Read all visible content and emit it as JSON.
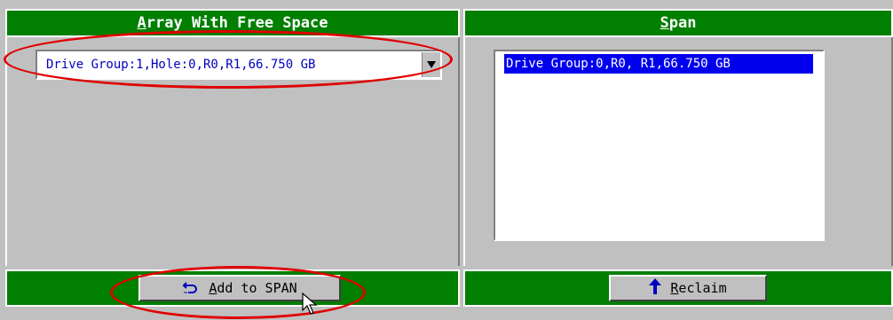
{
  "left_panel": {
    "header_accel": "A",
    "header_rest": "rray With Free Space",
    "combo_value": "Drive Group:1,Hole:0,R0,R1,66.750 GB",
    "add_button_accel": "A",
    "add_button_rest": "dd to SPAN",
    "add_icon": "undo-arrow-icon"
  },
  "right_panel": {
    "header_accel": "S",
    "header_rest": "pan",
    "list_items": [
      "Drive Group:0,R0, R1,66.750 GB"
    ],
    "reclaim_button_accel": "R",
    "reclaim_button_rest": "eclaim",
    "reclaim_icon": "up-arrow-icon"
  },
  "colors": {
    "header_bg": "#007f00",
    "selection": "#0000ee",
    "annotation": "#e00000"
  }
}
